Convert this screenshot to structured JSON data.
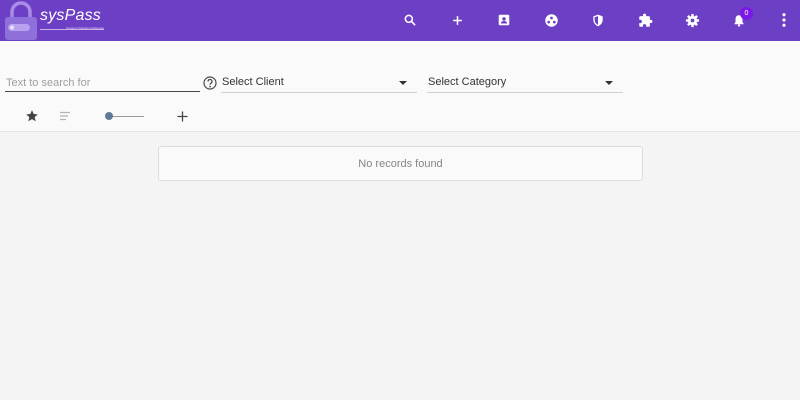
{
  "app": {
    "name": "sysPass",
    "tagline": "Systems Password Manager"
  },
  "header": {
    "icons": [
      "search-icon",
      "add-icon",
      "contacts-icon",
      "groups-icon",
      "security-icon",
      "extension-icon",
      "settings-icon",
      "notifications-icon",
      "more-vert-icon"
    ],
    "notification_count": "0"
  },
  "search": {
    "placeholder": "Text to search for",
    "value": ""
  },
  "filters": {
    "client": "Select Client",
    "category": "Select Category"
  },
  "toolbar": {
    "icons": [
      "star-icon",
      "sort-icon",
      "view-slider",
      "add-icon"
    ],
    "slider_value": 0
  },
  "results": {
    "empty_message": "No records found"
  },
  "colors": {
    "header": "#6d3fc4",
    "badge": "#7c18e6",
    "slider_thumb": "#607a96"
  }
}
